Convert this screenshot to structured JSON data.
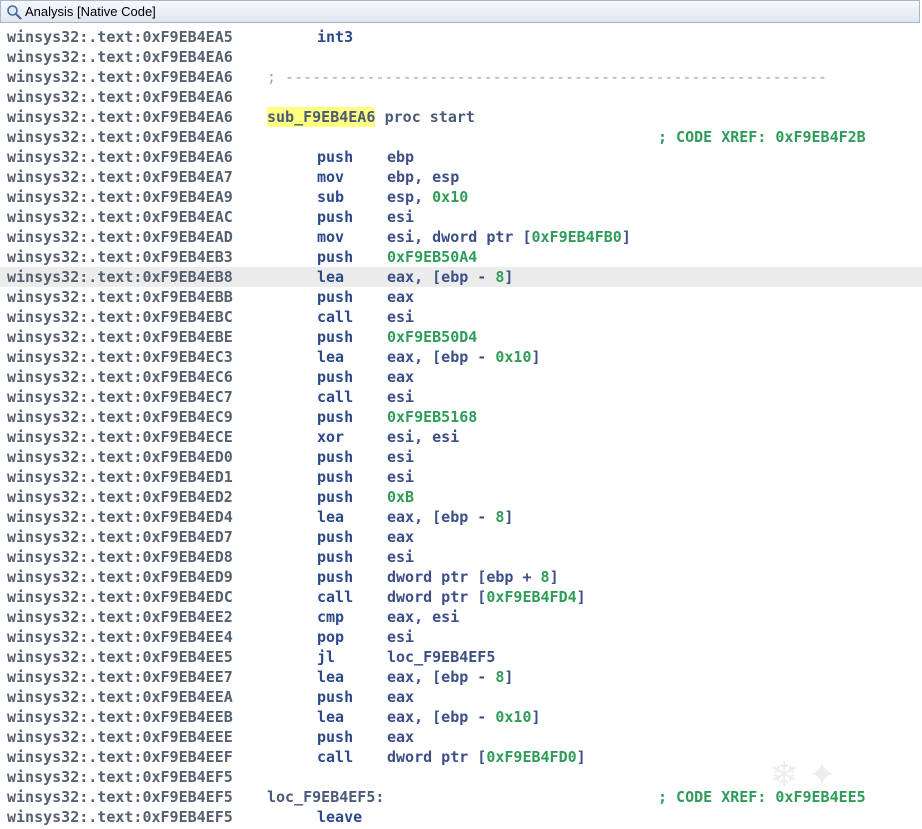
{
  "window": {
    "title": "Analysis [Native Code]"
  },
  "listing": {
    "rows": [
      {
        "addr": "winsys32:.text:0xF9EB4EA5",
        "mnemonic": "int3",
        "ops": ""
      },
      {
        "addr": "winsys32:.text:0xF9EB4EA6",
        "mnemonic": "",
        "ops": ""
      },
      {
        "addr": "winsys32:.text:0xF9EB4EA6",
        "separator": "; ------------------------------------------------------------"
      },
      {
        "addr": "winsys32:.text:0xF9EB4EA6",
        "mnemonic": "",
        "ops": ""
      },
      {
        "addr": "winsys32:.text:0xF9EB4EA6",
        "label": "sub_F9EB4EA6",
        "label_rest": " proc start",
        "label_highlight": true
      },
      {
        "addr": "winsys32:.text:0xF9EB4EA6",
        "comment": "; CODE XREF: 0xF9EB4F2B"
      },
      {
        "addr": "winsys32:.text:0xF9EB4EA6",
        "mnemonic": "push",
        "ops": "ebp"
      },
      {
        "addr": "winsys32:.text:0xF9EB4EA7",
        "mnemonic": "mov",
        "ops": "ebp, esp"
      },
      {
        "addr": "winsys32:.text:0xF9EB4EA9",
        "mnemonic": "sub",
        "ops": "esp, ",
        "num": "0x10"
      },
      {
        "addr": "winsys32:.text:0xF9EB4EAC",
        "mnemonic": "push",
        "ops": "esi"
      },
      {
        "addr": "winsys32:.text:0xF9EB4EAD",
        "mnemonic": "mov",
        "ops": "esi, dword ptr [",
        "num": "0xF9EB4FB0",
        "ops_after": "]"
      },
      {
        "addr": "winsys32:.text:0xF9EB4EB3",
        "mnemonic": "push",
        "ops": "",
        "num": "0xF9EB50A4"
      },
      {
        "addr": "winsys32:.text:0xF9EB4EB8",
        "mnemonic": "lea",
        "ops": "eax, [ebp - ",
        "num": "8",
        "ops_after": "]",
        "highlight": true
      },
      {
        "addr": "winsys32:.text:0xF9EB4EBB",
        "mnemonic": "push",
        "ops": "eax"
      },
      {
        "addr": "winsys32:.text:0xF9EB4EBC",
        "mnemonic": "call",
        "ops": "esi"
      },
      {
        "addr": "winsys32:.text:0xF9EB4EBE",
        "mnemonic": "push",
        "ops": "",
        "num": "0xF9EB50D4"
      },
      {
        "addr": "winsys32:.text:0xF9EB4EC3",
        "mnemonic": "lea",
        "ops": "eax, [ebp - ",
        "num": "0x10",
        "ops_after": "]"
      },
      {
        "addr": "winsys32:.text:0xF9EB4EC6",
        "mnemonic": "push",
        "ops": "eax"
      },
      {
        "addr": "winsys32:.text:0xF9EB4EC7",
        "mnemonic": "call",
        "ops": "esi"
      },
      {
        "addr": "winsys32:.text:0xF9EB4EC9",
        "mnemonic": "push",
        "ops": "",
        "num": "0xF9EB5168"
      },
      {
        "addr": "winsys32:.text:0xF9EB4ECE",
        "mnemonic": "xor",
        "ops": "esi, esi"
      },
      {
        "addr": "winsys32:.text:0xF9EB4ED0",
        "mnemonic": "push",
        "ops": "esi"
      },
      {
        "addr": "winsys32:.text:0xF9EB4ED1",
        "mnemonic": "push",
        "ops": "esi"
      },
      {
        "addr": "winsys32:.text:0xF9EB4ED2",
        "mnemonic": "push",
        "ops": "",
        "num": "0xB"
      },
      {
        "addr": "winsys32:.text:0xF9EB4ED4",
        "mnemonic": "lea",
        "ops": "eax, [ebp - ",
        "num": "8",
        "ops_after": "]"
      },
      {
        "addr": "winsys32:.text:0xF9EB4ED7",
        "mnemonic": "push",
        "ops": "eax"
      },
      {
        "addr": "winsys32:.text:0xF9EB4ED8",
        "mnemonic": "push",
        "ops": "esi"
      },
      {
        "addr": "winsys32:.text:0xF9EB4ED9",
        "mnemonic": "push",
        "ops": "dword ptr [ebp + ",
        "num": "8",
        "ops_after": "]"
      },
      {
        "addr": "winsys32:.text:0xF9EB4EDC",
        "mnemonic": "call",
        "ops": "dword ptr [",
        "num": "0xF9EB4FD4",
        "ops_after": "]"
      },
      {
        "addr": "winsys32:.text:0xF9EB4EE2",
        "mnemonic": "cmp",
        "ops": "eax, esi"
      },
      {
        "addr": "winsys32:.text:0xF9EB4EE4",
        "mnemonic": "pop",
        "ops": "esi"
      },
      {
        "addr": "winsys32:.text:0xF9EB4EE5",
        "mnemonic": "jl",
        "ops": "loc_F9EB4EF5"
      },
      {
        "addr": "winsys32:.text:0xF9EB4EE7",
        "mnemonic": "lea",
        "ops": "eax, [ebp - ",
        "num": "8",
        "ops_after": "]"
      },
      {
        "addr": "winsys32:.text:0xF9EB4EEA",
        "mnemonic": "push",
        "ops": "eax"
      },
      {
        "addr": "winsys32:.text:0xF9EB4EEB",
        "mnemonic": "lea",
        "ops": "eax, [ebp - ",
        "num": "0x10",
        "ops_after": "]"
      },
      {
        "addr": "winsys32:.text:0xF9EB4EEE",
        "mnemonic": "push",
        "ops": "eax"
      },
      {
        "addr": "winsys32:.text:0xF9EB4EEF",
        "mnemonic": "call",
        "ops": "dword ptr [",
        "num": "0xF9EB4FD0",
        "ops_after": "]"
      },
      {
        "addr": "winsys32:.text:0xF9EB4EF5",
        "mnemonic": "",
        "ops": ""
      },
      {
        "addr": "winsys32:.text:0xF9EB4EF5",
        "label": "loc_F9EB4EF5:",
        "comment": "; CODE XREF: 0xF9EB4EE5"
      },
      {
        "addr": "winsys32:.text:0xF9EB4EF5",
        "mnemonic": "leave",
        "ops": ""
      }
    ]
  },
  "colors": {
    "address": "#56606e",
    "mnemonic": "#2c4a8a",
    "operand": "#3c4f86",
    "number": "#2f9c5a",
    "label_highlight": "#ffff80",
    "row_highlight": "#ececec"
  }
}
